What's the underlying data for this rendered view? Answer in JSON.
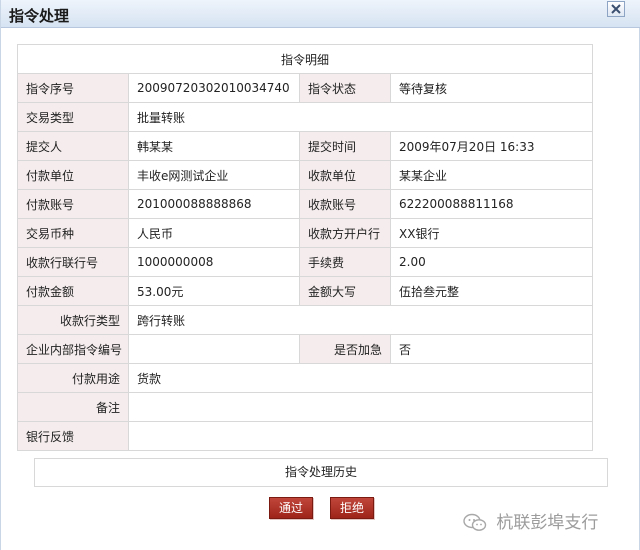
{
  "window": {
    "title": "指令处理"
  },
  "table": {
    "header": "指令明细",
    "rows": [
      {
        "label1": "指令序号",
        "value1": "20090720302010034740",
        "label2": "指令状态",
        "value2": "等待复核"
      },
      {
        "label1": "交易类型",
        "value1": "批量转账"
      },
      {
        "label1": "提交人",
        "value1": "韩某某",
        "label2": "提交时间",
        "value2": "2009年07月20日  16:33"
      },
      {
        "label1": "付款单位",
        "value1": "丰收e网测试企业",
        "label2": "收款单位",
        "value2": "某某企业"
      },
      {
        "label1": "付款账号",
        "value1": "201000088888868",
        "label2": "收款账号",
        "value2": "622200088811168"
      },
      {
        "label1": "交易币种",
        "value1": "人民币",
        "label2": "收款方开户行",
        "value2": "XX银行"
      },
      {
        "label1": "收款行联行号",
        "value1": "1000000008",
        "label2": "手续费",
        "value2": "2.00"
      },
      {
        "label1": "付款金额",
        "value1": "53.00元",
        "label2": "金额大写",
        "value2": "伍拾叁元整"
      },
      {
        "label1": "收款行类型",
        "value1": "跨行转账"
      },
      {
        "label1": "企业内部指令编号",
        "value1": "",
        "label2": "是否加急",
        "value2": "否"
      },
      {
        "label1": "付款用途",
        "value1": "货款"
      },
      {
        "label1": "备注",
        "value1": ""
      },
      {
        "label1": "银行反馈",
        "value1": ""
      }
    ]
  },
  "history": {
    "label": "指令处理历史"
  },
  "buttons": {
    "approve": "通过",
    "reject": "拒绝"
  },
  "watermark": {
    "text": "杭联彭埠支行"
  },
  "icons": {
    "close": "close-icon",
    "watermark": "wechat-icon"
  },
  "colors": {
    "label_bg": "#f5eded",
    "button_red": "#b0342a",
    "titlebar": "#d6e3f2"
  }
}
